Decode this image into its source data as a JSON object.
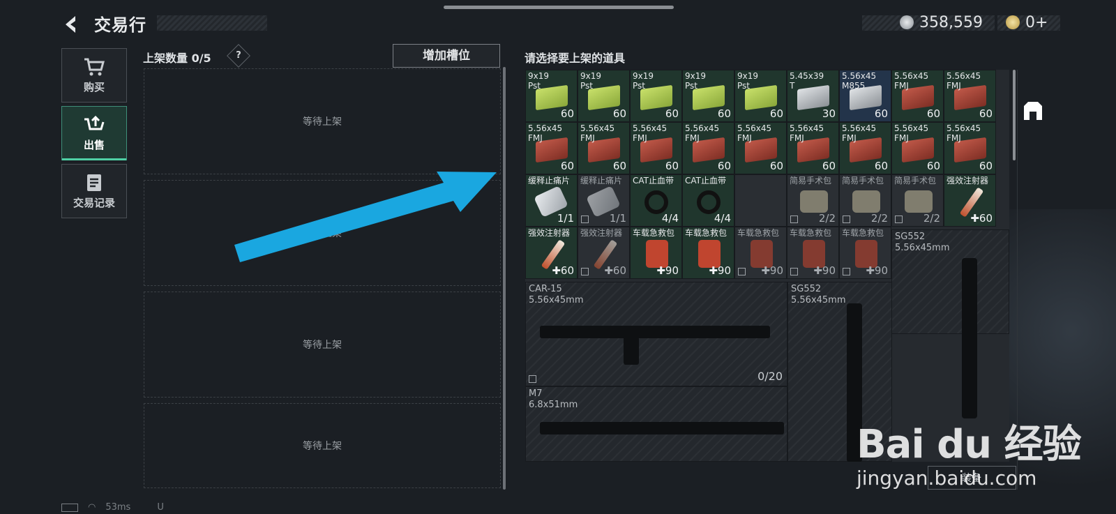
{
  "header": {
    "title": "交易行",
    "currencies": [
      {
        "icon": "silver-coin-icon",
        "value": "358,559"
      },
      {
        "icon": "gold-coin-icon",
        "value": "0+"
      }
    ]
  },
  "tabs": [
    {
      "label": "购买",
      "icon": "cart-icon"
    },
    {
      "label": "出售",
      "icon": "sell-upload-icon"
    },
    {
      "label": "交易记录",
      "icon": "records-icon"
    }
  ],
  "listing": {
    "count_label": "上架数量 0/5",
    "help": "?",
    "add_slot_label": "增加槽位",
    "slots": [
      "等待上架",
      "等待上架",
      "等待上架",
      "等待上架"
    ]
  },
  "inventory": {
    "title": "请选择要上架的道具",
    "rows": [
      [
        {
          "name": "9x19\nPst",
          "count": "60",
          "kind": "green"
        },
        {
          "name": "9x19\nPst",
          "count": "60",
          "kind": "green"
        },
        {
          "name": "9x19\nPst",
          "count": "60",
          "kind": "green"
        },
        {
          "name": "9x19\nPst",
          "count": "60",
          "kind": "green"
        },
        {
          "name": "9x19\nPst",
          "count": "60",
          "kind": "green"
        },
        {
          "name": "5.45x39\nT",
          "count": "30",
          "kind": "silver"
        },
        {
          "name": "5.56x45\nM855",
          "count": "60",
          "kind": "blue"
        },
        {
          "name": "5.56x45\nFMJ",
          "count": "60",
          "kind": "red"
        },
        {
          "name": "5.56x45\nFMJ",
          "count": "60",
          "kind": "red"
        }
      ],
      [
        {
          "name": "5.56x45\nFMJ",
          "count": "60",
          "kind": "red"
        },
        {
          "name": "5.56x45\nFMJ",
          "count": "60",
          "kind": "red"
        },
        {
          "name": "5.56x45\nFMJ",
          "count": "60",
          "kind": "red"
        },
        {
          "name": "5.56x45\nFMJ",
          "count": "60",
          "kind": "red"
        },
        {
          "name": "5.56x45\nFMJ",
          "count": "60",
          "kind": "red"
        },
        {
          "name": "5.56x45\nFMJ",
          "count": "60",
          "kind": "red"
        },
        {
          "name": "5.56x45\nFMJ",
          "count": "60",
          "kind": "red"
        },
        {
          "name": "5.56x45\nFMJ",
          "count": "60",
          "kind": "red"
        },
        {
          "name": "5.56x45\nFMJ",
          "count": "60",
          "kind": "red"
        }
      ],
      [
        {
          "name": "缓释止痛片",
          "count": "1/1",
          "kind": "pill"
        },
        {
          "name": "缓释止痛片",
          "count": "1/1",
          "kind": "pill-gray"
        },
        {
          "name": "CAT止血带",
          "count": "4/4",
          "kind": "band"
        },
        {
          "name": "CAT止血带",
          "count": "4/4",
          "kind": "band"
        },
        {
          "name": "",
          "count": "",
          "kind": "empty"
        },
        {
          "name": "简易手术包",
          "count": "2/2",
          "kind": "kit-gray"
        },
        {
          "name": "简易手术包",
          "count": "2/2",
          "kind": "kit-gray"
        },
        {
          "name": "简易手术包",
          "count": "2/2",
          "kind": "kit-gray"
        },
        {
          "name": "强效注射器",
          "count": "✚60",
          "kind": "syringe"
        }
      ],
      [
        {
          "name": "强效注射器",
          "count": "✚60",
          "kind": "syringe"
        },
        {
          "name": "强效注射器",
          "count": "✚60",
          "kind": "syringe-gray"
        },
        {
          "name": "车载急救包",
          "count": "✚90",
          "kind": "bag"
        },
        {
          "name": "车载急救包",
          "count": "✚90",
          "kind": "bag"
        },
        {
          "name": "车载急救包",
          "count": "✚90",
          "kind": "bag-gray"
        },
        {
          "name": "车载急救包",
          "count": "✚90",
          "kind": "bag-gray"
        },
        {
          "name": "车载急救包",
          "count": "✚90",
          "kind": "bag-gray"
        }
      ]
    ],
    "weapons": [
      {
        "name": "SG552\n5.56x45mm",
        "count": ""
      },
      {
        "name": "CAR-15\n5.56x45mm",
        "count": "0/20"
      },
      {
        "name": "SG552\n5.56x45mm",
        "count": ""
      },
      {
        "name": "M7\n6.8x51mm",
        "count": ""
      }
    ],
    "bottom_button": "装备"
  },
  "footer": {
    "latency": "53ms",
    "uid_prefix": "U"
  },
  "watermark": {
    "logo": "Bai du 经验",
    "url": "jingyan.baidu.com"
  },
  "colors": {
    "accent": "#4fd1a5",
    "arrow": "#1aa7e0"
  }
}
